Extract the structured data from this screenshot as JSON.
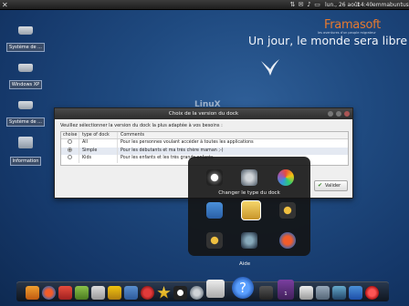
{
  "panel": {
    "date": "lun., 26 août",
    "time": "14:40",
    "user": "emmabuntus"
  },
  "banner": {
    "brand": "Framasoft",
    "tagline": "les aventures d'un peuple migrateur",
    "slogan": "Un jour, le monde sera libre !"
  },
  "desktop": {
    "icons": [
      {
        "label": "Système de ..."
      },
      {
        "label": "Windows XP"
      },
      {
        "label": "Système de ..."
      },
      {
        "label": "Information"
      }
    ],
    "watermark": "LinuX"
  },
  "dialog": {
    "title": "Choix de la version du dock",
    "prompt": "Veuillez sélectionner la version du dock la plus adaptée à vos besoins :",
    "headers": [
      "choise",
      "type of dock",
      "Comments"
    ],
    "rows": [
      {
        "type": "All",
        "comment": "Pour les personnes voulant accéder à toutes les applications",
        "selected": false
      },
      {
        "type": "Simple",
        "comment": "Pour les débutants et ma très chère maman ;-)",
        "selected": true
      },
      {
        "type": "Kids",
        "comment": "Pour les enfants et les très grands enfants",
        "selected": false
      }
    ],
    "validate_label": "Valider"
  },
  "chooser": {
    "title": "Changer le type du dock",
    "tooltip": "Aide"
  },
  "dock": {
    "workspace_number": "1"
  },
  "colors": {
    "brand": "#e87a2e",
    "desktop": "#1f4a80",
    "dialog_titlebar": "#2c2c2c"
  }
}
